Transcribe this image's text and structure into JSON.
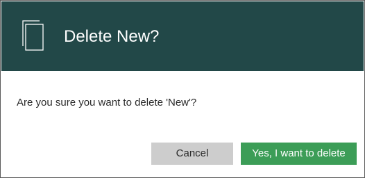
{
  "dialog": {
    "title": "Delete New?",
    "header_icon": "document-icon",
    "message": "Are you sure you want to delete 'New'?",
    "cancel_label": "Cancel",
    "confirm_label": "Yes, I want to delete",
    "colors": {
      "header_background": "#224848",
      "header_text": "#ffffff",
      "cancel_background": "#cdcdcd",
      "confirm_background": "#3c9d57",
      "confirm_text": "#ffffff"
    }
  }
}
